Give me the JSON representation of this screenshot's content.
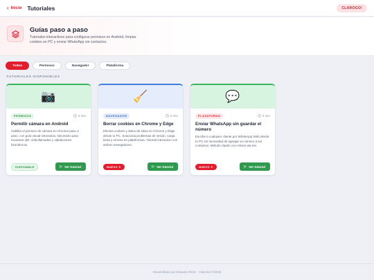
{
  "topbar": {
    "back_label": "Inicio",
    "title": "Tutoriales",
    "brand": "CLAROGO!"
  },
  "hero": {
    "icon": "layers-icon",
    "title": "Guías paso a paso",
    "description": "Tutoriales interactivos para configurar permisos en Android, limpiar cookies en PC y enviar WhatsApp sin contactos."
  },
  "filters": [
    {
      "label": "Todos",
      "active": true
    },
    {
      "label": "Permisos",
      "active": false
    },
    {
      "label": "Navegador",
      "active": false
    },
    {
      "label": "Plataforma",
      "active": false
    }
  ],
  "section_label": "TUTORIALES DISPONIBLES",
  "cards": [
    {
      "icon": "📷",
      "icon_name": "camera-icon",
      "head_color": "#d6f4df",
      "accent": "#39b65c",
      "badge": "PERMISOS",
      "badge_bg": "#e4f6e8",
      "badge_color": "#2f8a45",
      "duration": "2 min",
      "title": "Permitir cámara en Android",
      "description": "Habilita el permiso de cámara en Chrome paso a paso, con guía visual interactiva. Necesario para escanear QR, videollamadas y validaciones biométricas.",
      "status": "DISPONIBLE",
      "button": "Ver tutorial"
    },
    {
      "icon": "🧹",
      "icon_name": "broom-icon",
      "head_color": "#e5ecfb",
      "accent": "#3f7be0",
      "badge": "NAVEGADOR",
      "badge_bg": "#e3ebfb",
      "badge_color": "#3565c4",
      "duration": "3 min",
      "title": "Borrar cookies en Chrome y Edge",
      "description": "Elimina cookies y datos de sitios en Chrome y Edge desde tu PC. Soluciona problemas de sesión, carga lenta y errores en plataformas. Tutorial interactivo con ambos navegadores.",
      "status": "NUEVO ✦",
      "button": "Ver tutorial"
    },
    {
      "icon": "💬",
      "icon_name": "speech-bubble-icon",
      "head_color": "#d6f4df",
      "accent": "#39b65c",
      "badge": "PLATAFORMA",
      "badge_bg": "#fde4e6",
      "badge_color": "#d81b2a",
      "duration": "3 min",
      "title": "Enviar WhatsApp sin guardar el número",
      "description": "Escribe a cualquier cliente por WhatsApp Web desde tu PC sin necesidad de agregar su número a los contactos. Método rápido con enlace wa.me.",
      "status": "NUEVO ✦",
      "button": "Ver tutorial"
    }
  ],
  "footer": "Desarrollado por Eduardo Pérez · ClaroGo! ©2025"
}
